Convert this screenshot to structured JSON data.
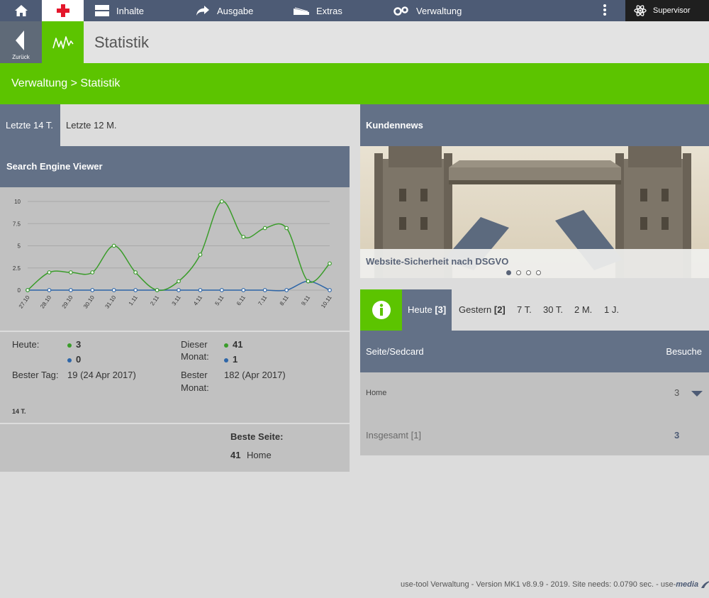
{
  "topnav": {
    "items": [
      {
        "label": "Inhalte",
        "icon": "content-icon"
      },
      {
        "label": "Ausgabe",
        "icon": "share-arrow-icon"
      },
      {
        "label": "Extras",
        "icon": "extras-icon"
      },
      {
        "label": "Verwaltung",
        "icon": "gears-icon"
      }
    ],
    "user": "Supervisor"
  },
  "secondbar": {
    "back_label": "Zurück",
    "title": "Statistik"
  },
  "breadcrumb": "Verwaltung > Statistik",
  "period_tabs": [
    "Letzte 14 T.",
    "Letzte 12 M."
  ],
  "search_engine_viewer": {
    "title": "Search Engine Viewer"
  },
  "chart_data": {
    "type": "line",
    "x": [
      "27.10",
      "28.10",
      "29.10",
      "30.10",
      "31.10",
      "1.11",
      "2.11",
      "3.11",
      "4.11",
      "5.11",
      "6.11",
      "7.11",
      "8.11",
      "9.11",
      "10.11"
    ],
    "yticks": [
      "0",
      "2.5",
      "5",
      "7.5",
      "10"
    ],
    "ylim": [
      0,
      10
    ],
    "grid": true,
    "series": [
      {
        "color": "#3a9c2a",
        "values": [
          0,
          2,
          2,
          2,
          5,
          2,
          0,
          1,
          4,
          10,
          6,
          7,
          7,
          1,
          3
        ]
      },
      {
        "color": "#2e66a8",
        "values": [
          0,
          0,
          0,
          0,
          0,
          0,
          0,
          0,
          0,
          0,
          0,
          0,
          0,
          1,
          0
        ]
      }
    ]
  },
  "stats": {
    "heute_label": "Heute:",
    "heute_green": "3",
    "heute_blue": "0",
    "monat_label_1": "Dieser",
    "monat_label_2": "Monat:",
    "monat_green": "41",
    "monat_blue": "1",
    "bester_tag_label": "Bester Tag:",
    "bester_tag_value": "19 (24 Apr 2017)",
    "bester_monat_label_1": "Bester",
    "bester_monat_label_2": "Monat:",
    "bester_monat_value": "182 (Apr 2017)",
    "period": "14 T."
  },
  "beste_seite": {
    "label": "Beste Seite:",
    "count": "41",
    "page": "Home"
  },
  "kundennews": {
    "title": "Kundennews",
    "caption": "Website-Sicherheit nach DSGVO"
  },
  "visits": {
    "tabs": [
      {
        "label": "Heute",
        "count": "[3]"
      },
      {
        "label": "Gestern",
        "count": "[2]"
      },
      {
        "label": "7 T.",
        "count": ""
      },
      {
        "label": "30 T.",
        "count": ""
      },
      {
        "label": "2 M.",
        "count": ""
      },
      {
        "label": "1 J.",
        "count": ""
      }
    ],
    "col_page": "Seite/Sedcard",
    "col_visits": "Besuche",
    "rows": [
      {
        "page": "Home",
        "visits": "3"
      }
    ],
    "total_label": "Insgesamt [1]",
    "total_value": "3"
  },
  "footer": {
    "text": "use-tool Verwaltung - Version MK1 v8.9.9 - 2019. Site needs: 0.0790 sec. - use-",
    "brand": "media"
  }
}
